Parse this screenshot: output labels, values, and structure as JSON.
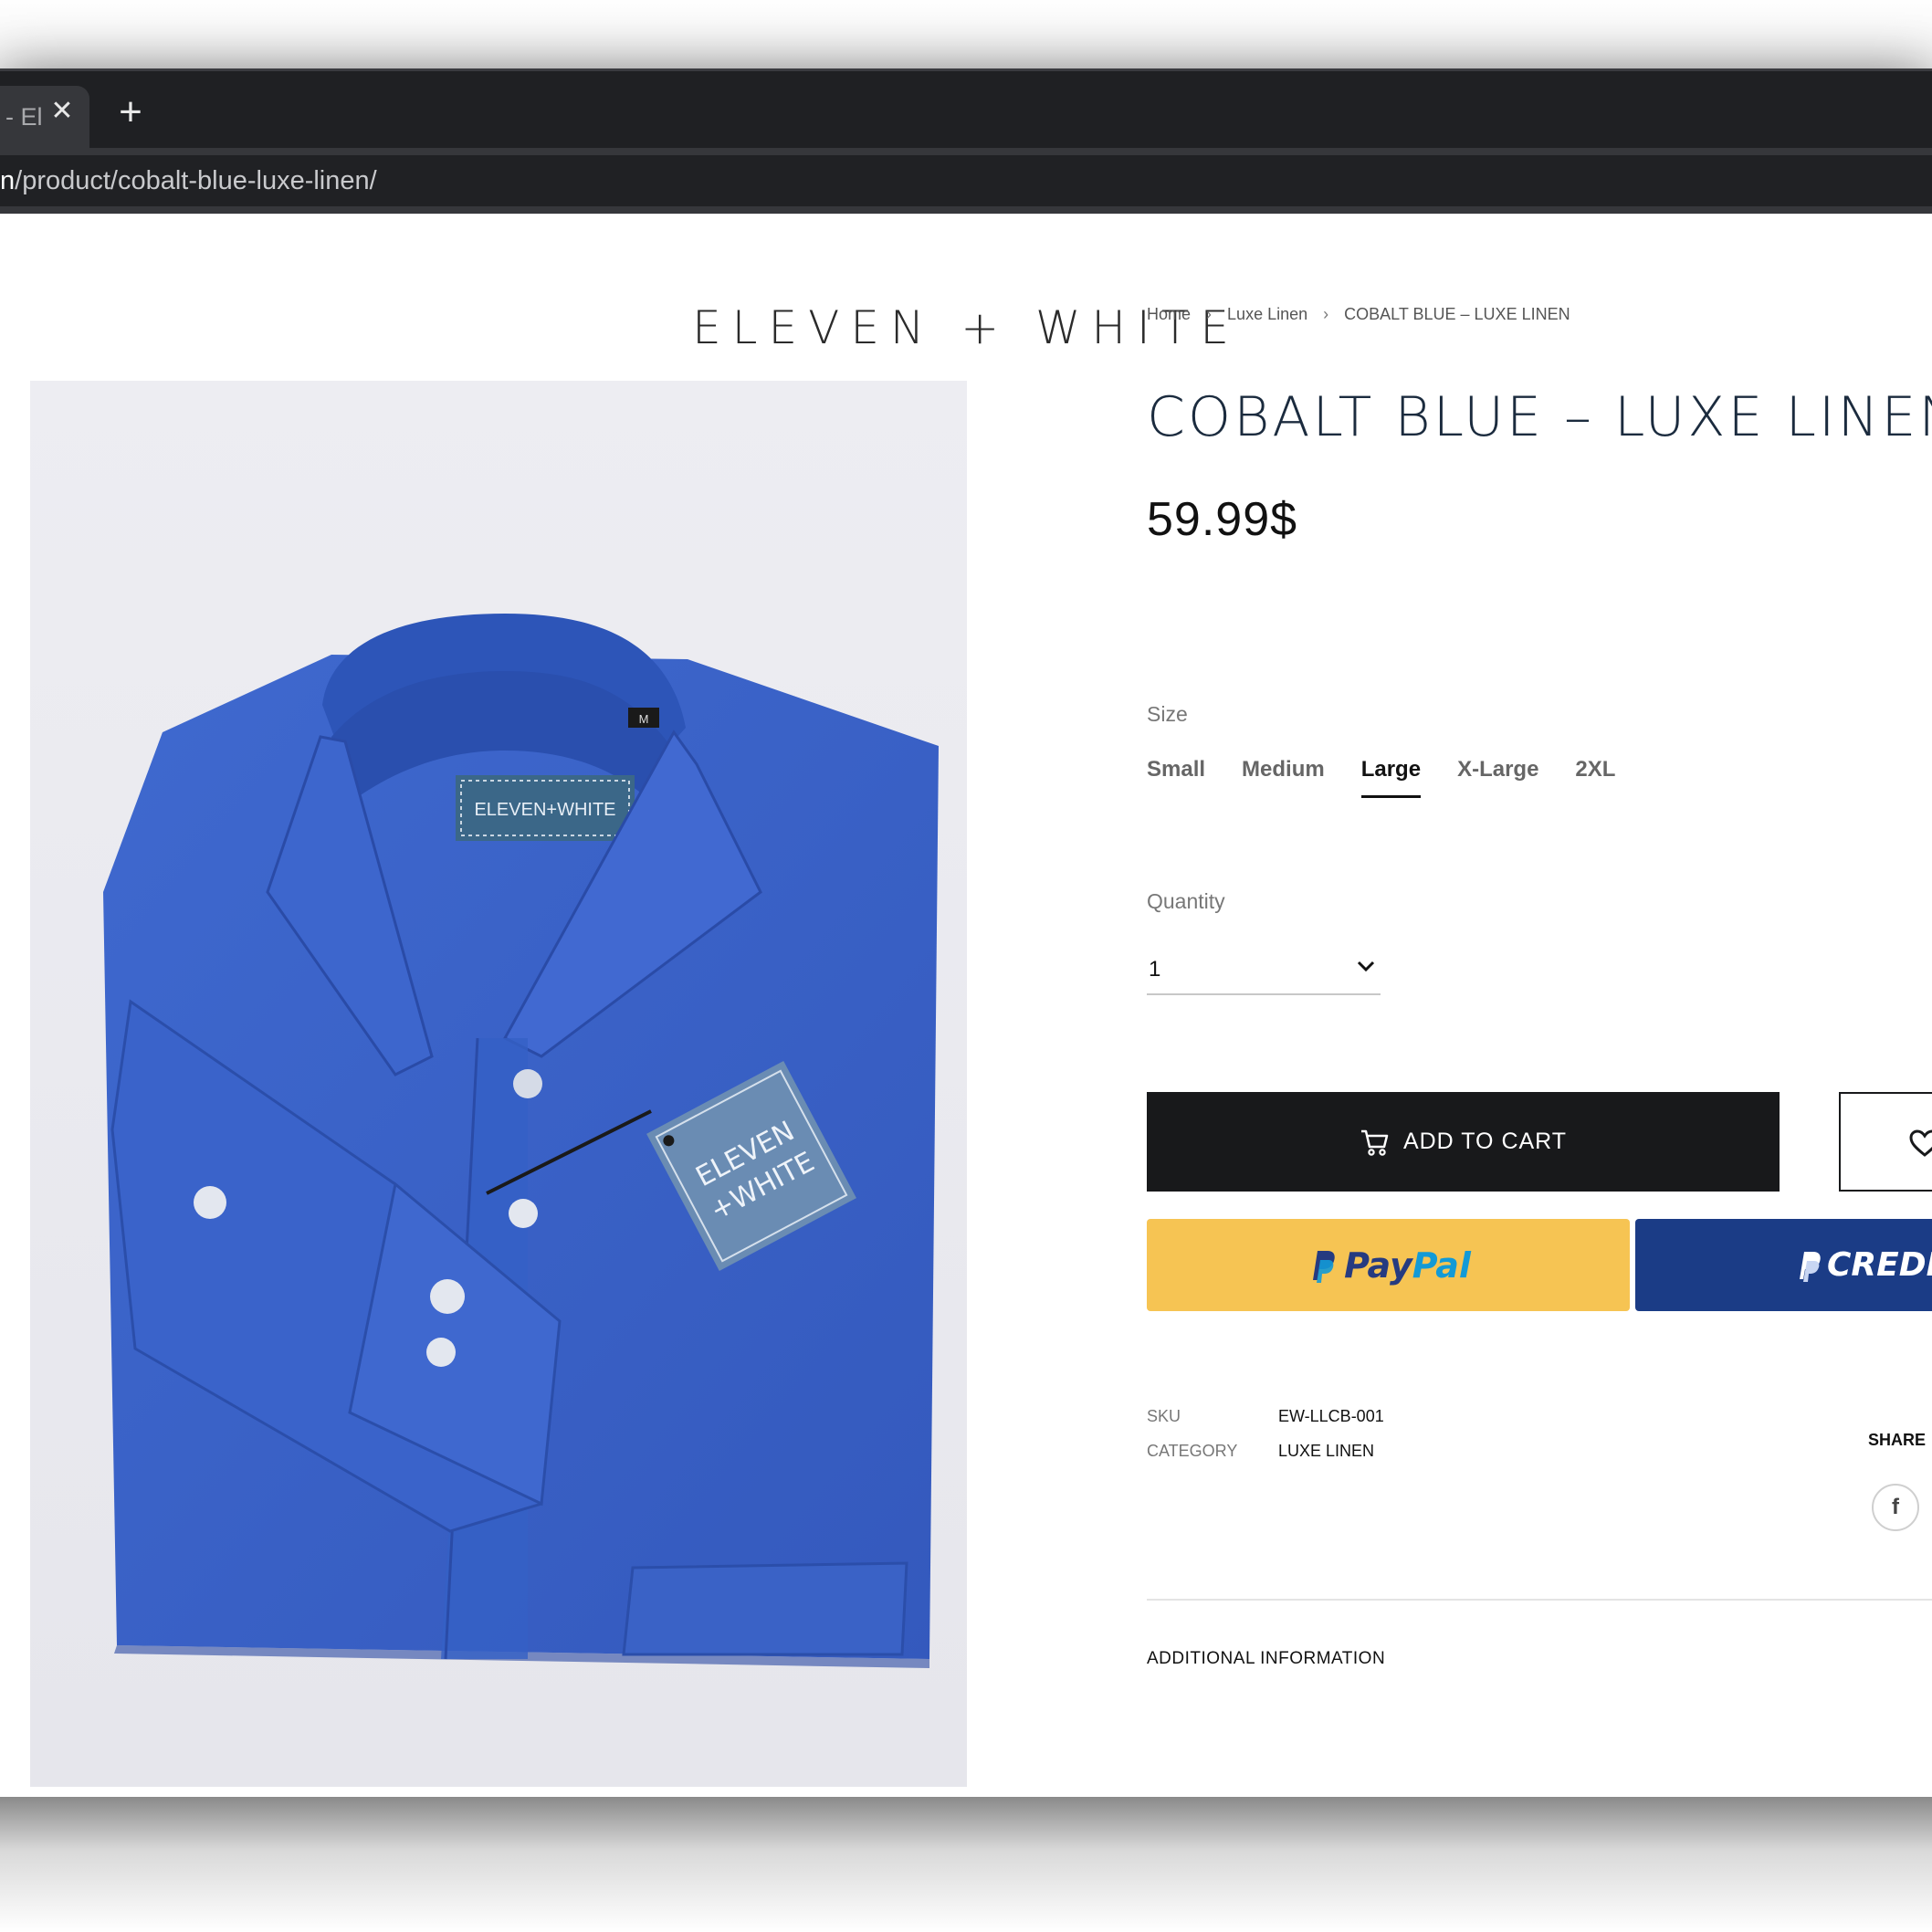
{
  "browser": {
    "tab_title": "- El",
    "tab_close": "✕",
    "new_tab": "+",
    "url_host": "n",
    "url_path": "/product/cobalt-blue-luxe-linen/"
  },
  "site": {
    "logo": "ELEVEN + WHITE"
  },
  "product_image": {
    "collar_label": "ELEVEN+WHITE",
    "size_label": "M",
    "tag_line1": "ELEVEN",
    "tag_line2": "+WHITE"
  },
  "breadcrumb": {
    "home": "Home",
    "category": "Luxe Linen",
    "current": "COBALT BLUE – LUXE LINEN",
    "separator": "›"
  },
  "product": {
    "title": "COBALT BLUE – LUXE LINEN",
    "price": "59.99$"
  },
  "size": {
    "label": "Size",
    "options": [
      "Small",
      "Medium",
      "Large",
      "X-Large",
      "2XL"
    ],
    "selected": "Large"
  },
  "quantity": {
    "label": "Quantity",
    "value": "1"
  },
  "actions": {
    "add_to_cart": "ADD TO CART",
    "paypal_pay": "Pay",
    "paypal_pal": "Pal",
    "credit": "CREDIT"
  },
  "meta": {
    "sku_label": "SKU",
    "sku_value": "EW-LLCB-001",
    "category_label": "CATEGORY",
    "category_value": "LUXE LINEN",
    "share_label": "SHARE",
    "facebook_glyph": "f"
  },
  "tabs": {
    "additional_information": "ADDITIONAL INFORMATION"
  },
  "colors": {
    "shirt": "#3a62c6",
    "paypal_yellow": "#f6c453",
    "credit_navy": "#1b3c86",
    "cart_button": "#18191b"
  }
}
